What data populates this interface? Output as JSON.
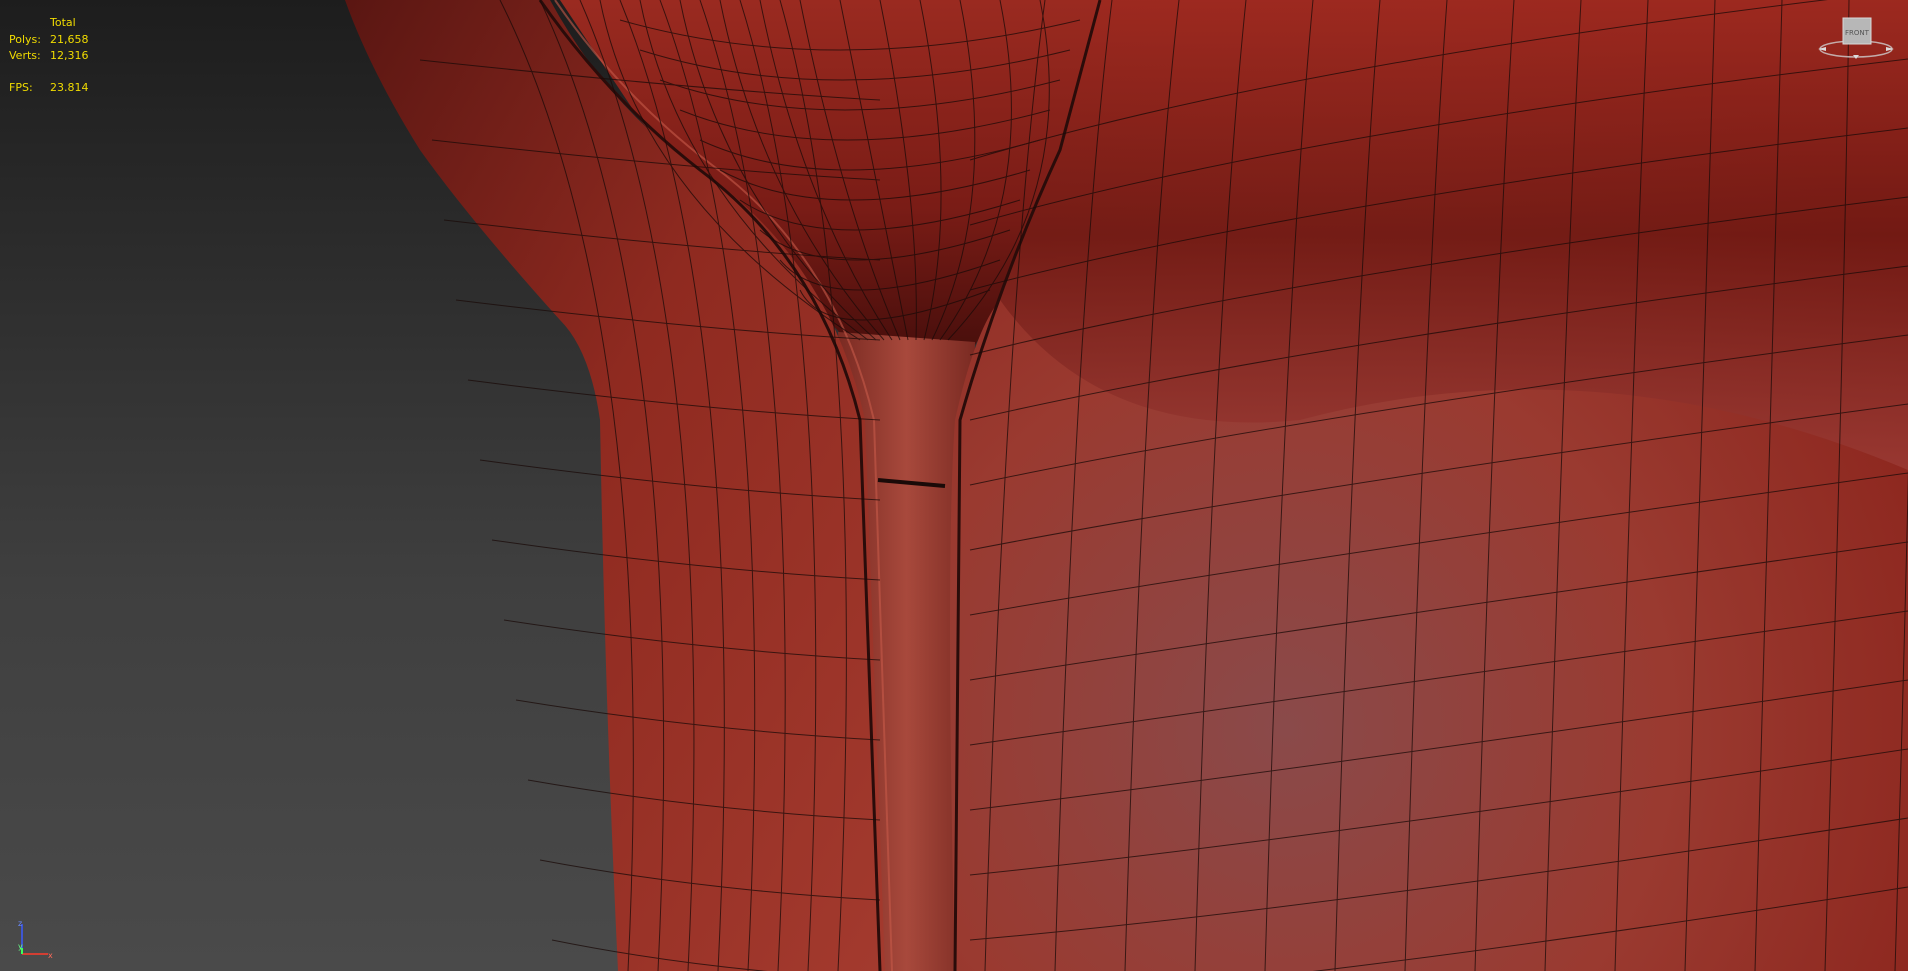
{
  "viewport": {
    "stats": {
      "header": "Total",
      "polys_label": "Polys:",
      "polys_value": "21,658",
      "verts_label": "Verts:",
      "verts_value": "12,316",
      "fps_label": "FPS:",
      "fps_value": "23.814"
    },
    "viewcube": {
      "face_label": "FRONT"
    },
    "axis_gizmo": {
      "x": "x",
      "y": "y",
      "z": "z"
    }
  },
  "colors": {
    "stats_text": "#f1dc00",
    "mesh_base": "#a83226",
    "mesh_dark": "#5a1410",
    "wire": "#1a0a08"
  }
}
